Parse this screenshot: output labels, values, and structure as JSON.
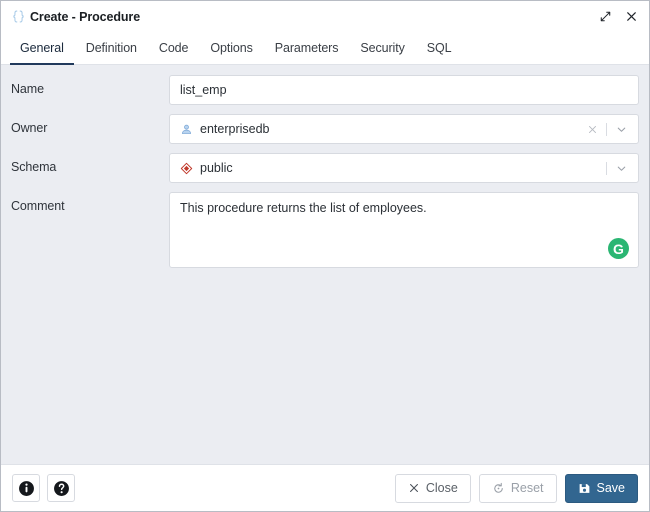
{
  "window": {
    "title": "Create - Procedure",
    "icon": "procedure-braces-icon",
    "expand_icon": "expand-diagonal-icon",
    "close_icon": "close-x-icon"
  },
  "tabs": [
    {
      "label": "General",
      "active": true
    },
    {
      "label": "Definition",
      "active": false
    },
    {
      "label": "Code",
      "active": false
    },
    {
      "label": "Options",
      "active": false
    },
    {
      "label": "Parameters",
      "active": false
    },
    {
      "label": "Security",
      "active": false
    },
    {
      "label": "SQL",
      "active": false
    }
  ],
  "form": {
    "name": {
      "label": "Name",
      "value": "list_emp",
      "placeholder": ""
    },
    "owner": {
      "label": "Owner",
      "value": "enterprisedb",
      "icon": "role-user-icon",
      "clear_icon": "clear-x-icon",
      "dropdown_icon": "chevron-down-icon"
    },
    "schema": {
      "label": "Schema",
      "value": "public",
      "icon": "schema-diamond-icon",
      "dropdown_icon": "chevron-down-icon"
    },
    "comment": {
      "label": "Comment",
      "value": "This procedure returns the list of employees.",
      "placeholder": "",
      "badge": "G",
      "badge_name": "grammarly-badge"
    }
  },
  "footer": {
    "info_icon": "info-circle-icon",
    "help_icon": "help-circle-icon",
    "close_label": "Close",
    "reset_label": "Reset",
    "save_label": "Save"
  },
  "colors": {
    "accent": "#326690",
    "tab_underline": "#213a5c",
    "body_bg": "#ebedf2",
    "grammarly_green": "#2bb673",
    "schema_red": "#c0392b",
    "owner_blue": "#8fb4e0"
  }
}
